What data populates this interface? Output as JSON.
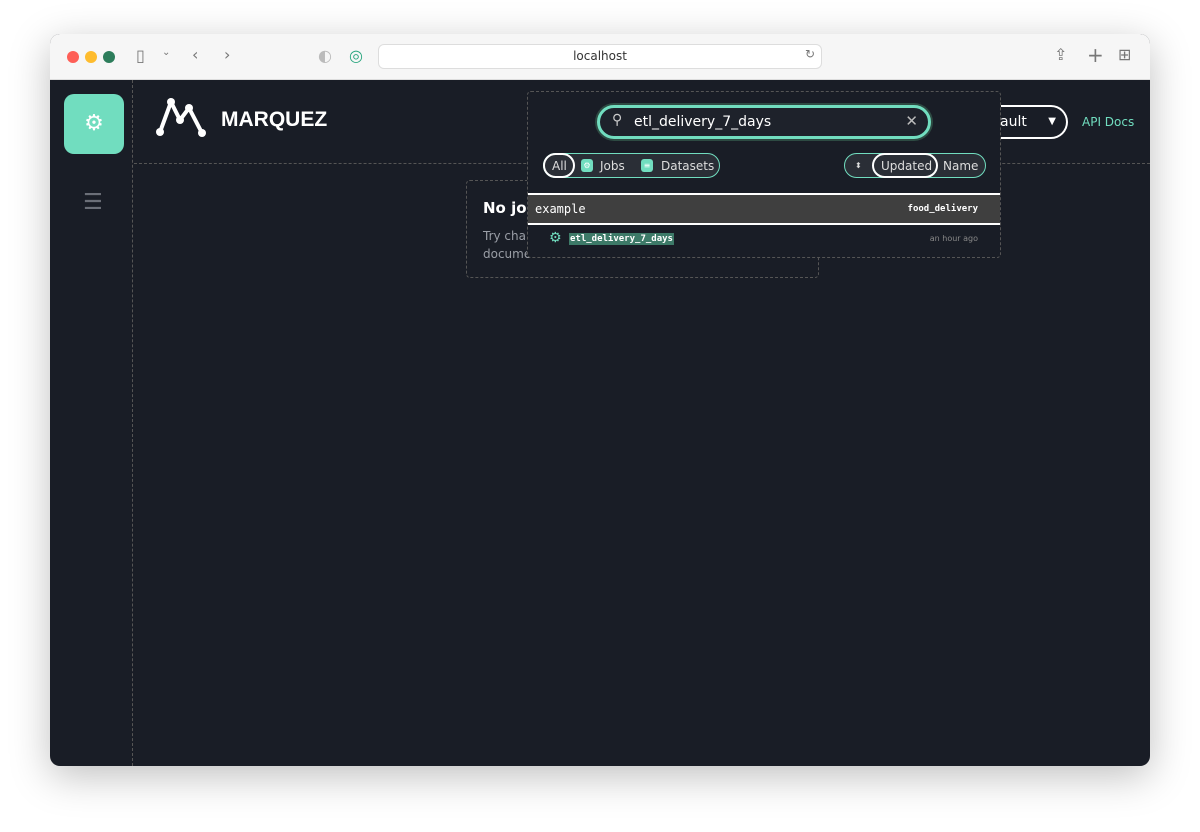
{
  "browser": {
    "url": "localhost"
  },
  "app": {
    "brand": "MARQUEZ",
    "namespace_partial": "ault",
    "api_docs": "API Docs"
  },
  "empty": {
    "title_partial": "No job",
    "line1_partial": "Try char",
    "line2_partial": "docume"
  },
  "search": {
    "value": "etl_delivery_7_days",
    "filters": [
      "All",
      "Jobs",
      "Datasets"
    ],
    "active_filter": "All",
    "sort": [
      "Updated",
      "Name"
    ],
    "active_sort": "Updated"
  },
  "results": {
    "group": "example",
    "group_namespace": "food_delivery",
    "items": [
      {
        "name": "etl_delivery_7_days",
        "time": "an hour ago",
        "type": "job"
      }
    ]
  },
  "colors": {
    "accent": "#71ddbf",
    "background": "#191d26"
  }
}
